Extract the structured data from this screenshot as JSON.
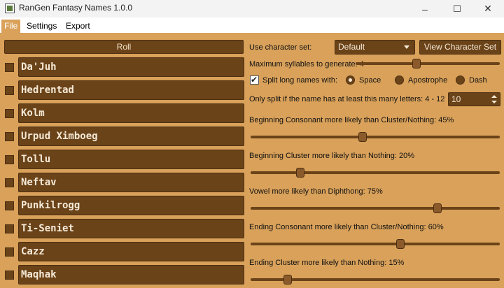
{
  "window": {
    "title": "RanGen Fantasy Names 1.0.0",
    "minimize": "–",
    "maximize": "☐",
    "close": "✕"
  },
  "menu": [
    {
      "label": "File",
      "active": true
    },
    {
      "label": "Settings",
      "active": false
    },
    {
      "label": "Export",
      "active": false
    }
  ],
  "roll_label": "Roll",
  "names": [
    "Da'Juh",
    "Hedrentad",
    "Kolm",
    "Urpud Ximboeg",
    "Tollu",
    "Neftav",
    "Punkilrogg",
    "Ti-Seniet",
    "Cazz",
    "Maqhak"
  ],
  "settings": {
    "character_set_label": "Use character set:",
    "character_set_value": "Default",
    "view_button": "View Character Set",
    "max_syllables_label": "Maximum syllables to generate: 4",
    "max_syllables_value": 0.42,
    "split_label": "Split long names with:",
    "split_checked": true,
    "split_options": [
      "Space",
      "Apostrophe",
      "Dash"
    ],
    "split_selected": 0,
    "min_letters_label": "Only split if the name has at least this many letters: 4 - 12",
    "min_letters_value": "10",
    "sliders": [
      {
        "label": "Beginning Consonant more likely than Cluster/Nothing: 45%",
        "value": 0.45
      },
      {
        "label": "Beginning Cluster more likely than Nothing: 20%",
        "value": 0.2
      },
      {
        "label": "Vowel more likely than Diphthong: 75%",
        "value": 0.75
      },
      {
        "label": "Ending Consonant more likely than Cluster/Nothing: 60%",
        "value": 0.6
      },
      {
        "label": "Ending Cluster more likely than Nothing: 15%",
        "value": 0.15
      }
    ]
  }
}
